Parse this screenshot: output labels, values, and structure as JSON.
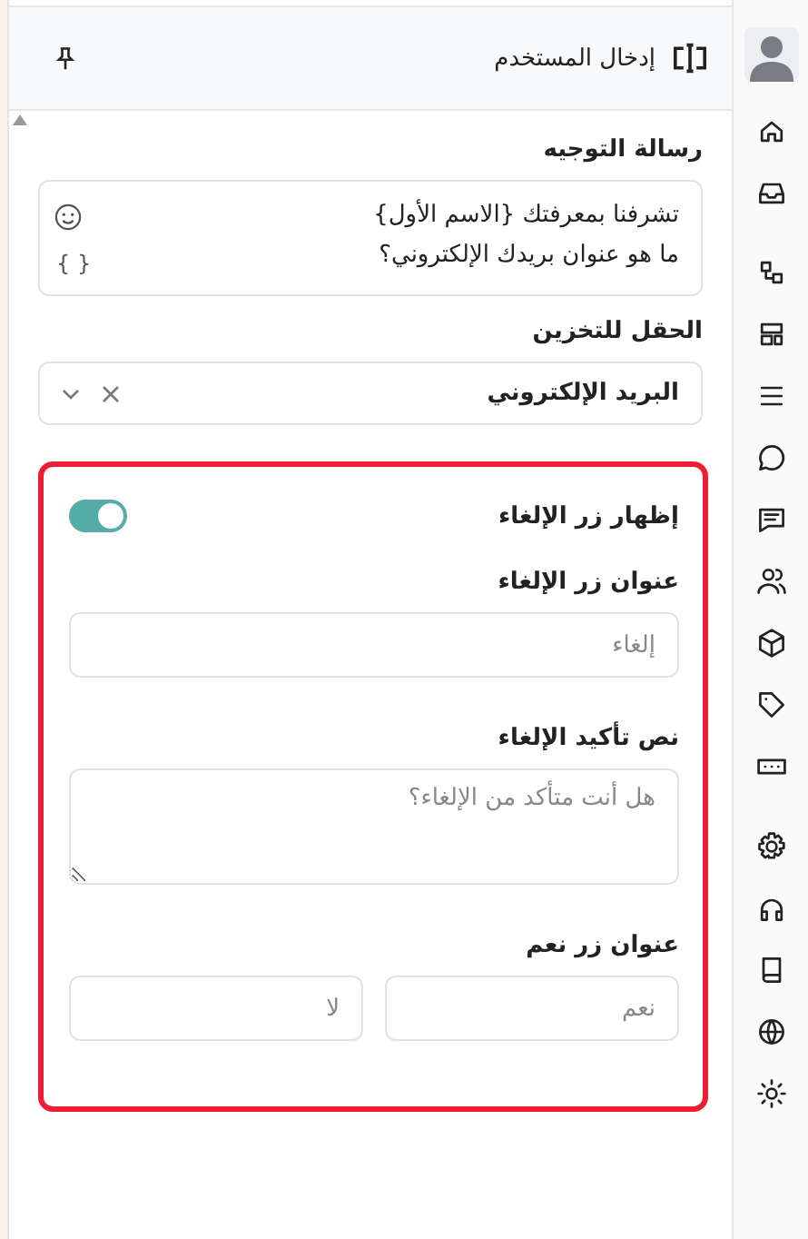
{
  "header": {
    "title": "إدخال المستخدم"
  },
  "prompt": {
    "label": "رسالة التوجيه",
    "text": "تشرفنا بمعرفتك {الاسم الأول}\nما هو عنوان بريدك الإلكتروني؟",
    "variable_icon": "{ }"
  },
  "storage": {
    "label": "الحقل للتخزين",
    "value": "البريد الإلكتروني"
  },
  "cancel_section": {
    "highlighted": true,
    "toggle": {
      "label": "إظهار زر الإلغاء",
      "on": true
    },
    "cancel_title": {
      "label": "عنوان زر الإلغاء",
      "placeholder": "إلغاء"
    },
    "confirm_text": {
      "label": "نص تأكيد الإلغاء",
      "placeholder": "هل أنت متأكد من الإلغاء؟"
    },
    "yes_title": {
      "label": "عنوان زر نعم",
      "placeholders": [
        "نعم",
        "لا"
      ]
    }
  }
}
